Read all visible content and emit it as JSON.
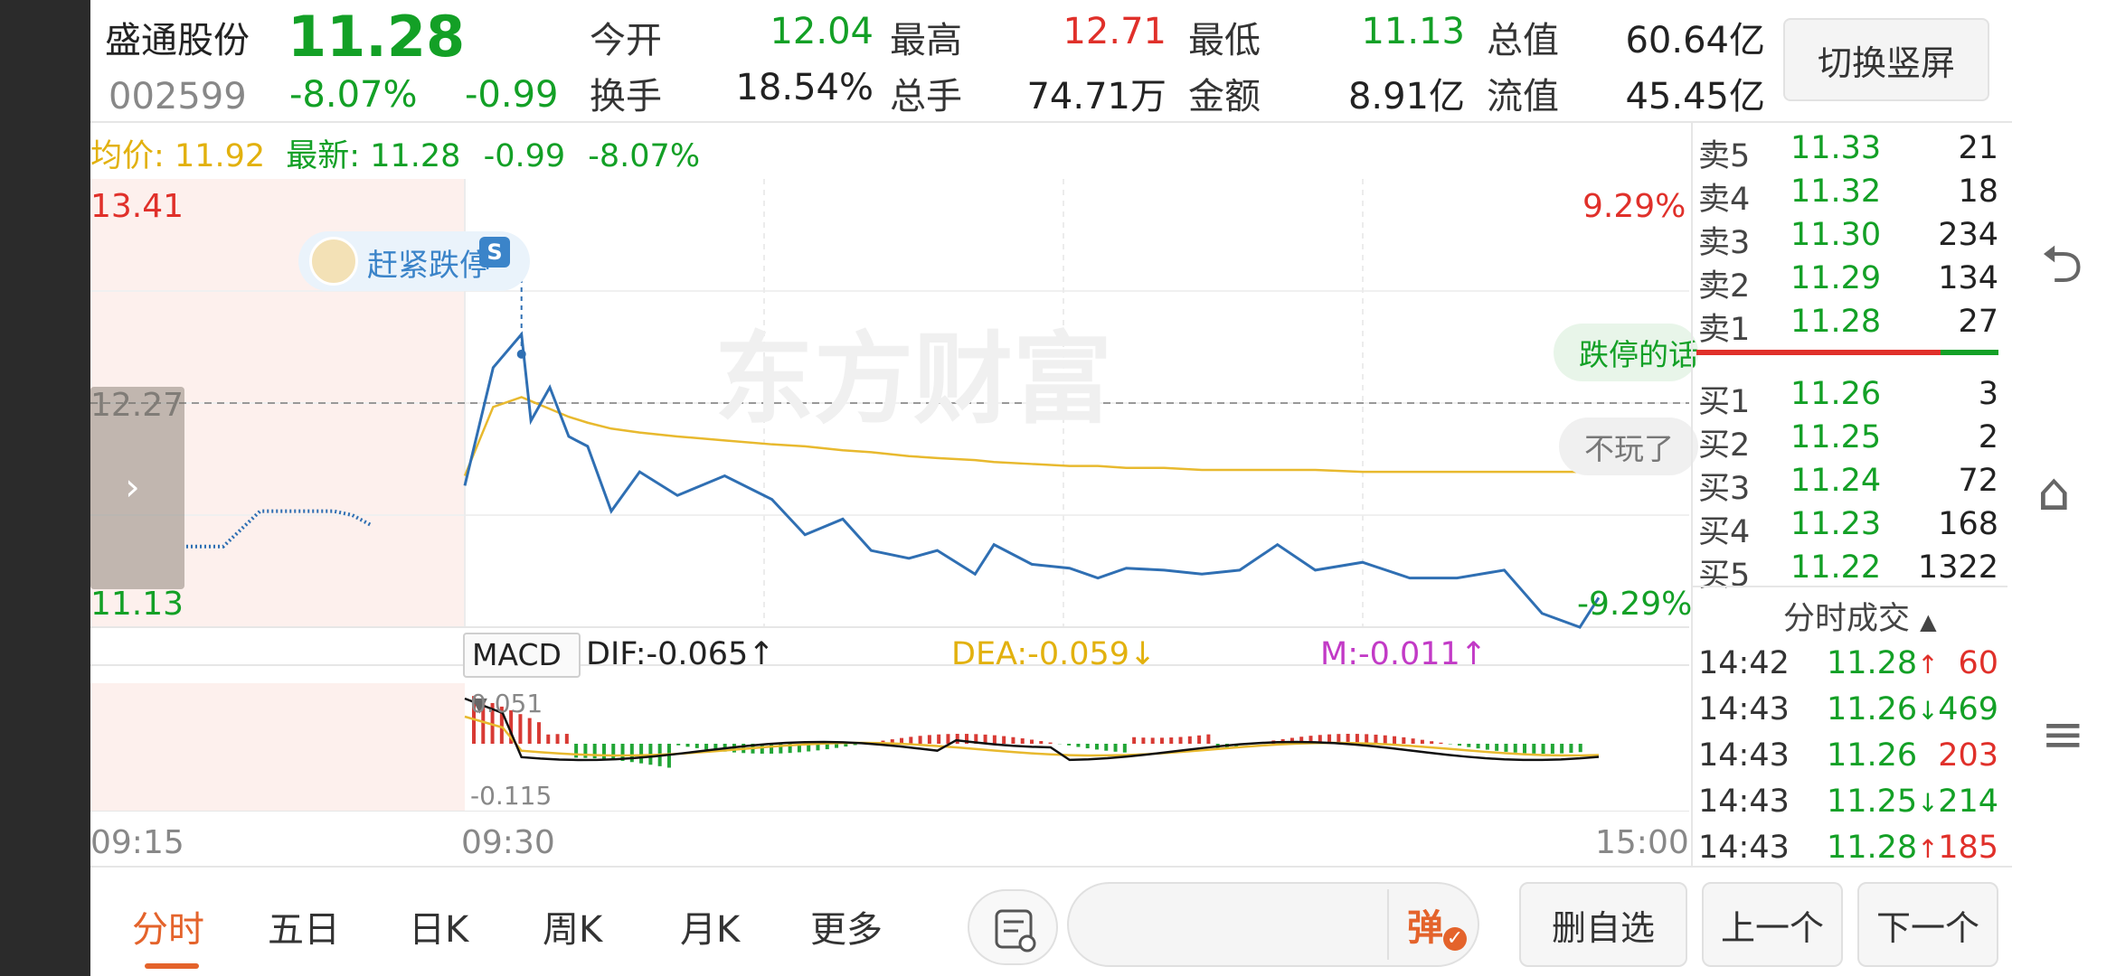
{
  "header": {
    "stock_name": "盛通股份",
    "price": "11.28",
    "code": "002599",
    "change_pct": "-8.07%",
    "change": "-0.99",
    "switch_label": "切换竖屏"
  },
  "stats": [
    {
      "label": "今开",
      "value": "12.04",
      "color": "#13a026"
    },
    {
      "label": "最高",
      "value": "12.71",
      "color": "#e0302a"
    },
    {
      "label": "最低",
      "value": "11.13",
      "color": "#13a026"
    },
    {
      "label": "总值",
      "value": "60.64亿",
      "color": "#222222"
    },
    {
      "label": "换手",
      "value": "18.54%",
      "color": "#222222"
    },
    {
      "label": "总手",
      "value": "74.71万",
      "color": "#222222"
    },
    {
      "label": "金额",
      "value": "8.91亿",
      "color": "#222222"
    },
    {
      "label": "流值",
      "value": "45.45亿",
      "color": "#222222"
    }
  ],
  "legend": {
    "avg_label": "均价:",
    "avg_value": "11.92",
    "latest_label": "最新:",
    "latest_value": "11.28",
    "change": "-0.99",
    "change_pct": "-8.07%"
  },
  "price_axis": {
    "high": "13.41",
    "mid": "12.27",
    "low": "11.13",
    "high_pct": "9.29%",
    "low_pct": "-9.29%"
  },
  "time_axis": [
    "09:15",
    "09:30",
    "15:00"
  ],
  "badge_text": "赶紧跌停",
  "side_pills": {
    "green": "跌停的话",
    "gray": "不玩了"
  },
  "watermark": "东方财富",
  "macd": {
    "selector": "MACD",
    "dif": "DIF:-0.065",
    "dea": "DEA:-0.059",
    "m": "M:-0.011",
    "top_value": "0.051",
    "bottom_value": "-0.115"
  },
  "order_book": {
    "asks": [
      {
        "label": "卖5",
        "price": "11.33",
        "vol": "21"
      },
      {
        "label": "卖4",
        "price": "11.32",
        "vol": "18"
      },
      {
        "label": "卖3",
        "price": "11.30",
        "vol": "234"
      },
      {
        "label": "卖2",
        "price": "11.29",
        "vol": "134"
      },
      {
        "label": "卖1",
        "price": "11.28",
        "vol": "27"
      }
    ],
    "bids": [
      {
        "label": "买1",
        "price": "11.26",
        "vol": "3"
      },
      {
        "label": "买2",
        "price": "11.25",
        "vol": "2"
      },
      {
        "label": "买3",
        "price": "11.24",
        "vol": "72"
      },
      {
        "label": "买4",
        "price": "11.23",
        "vol": "168"
      },
      {
        "label": "买5",
        "price": "11.22",
        "vol": "1322"
      }
    ]
  },
  "ticks": {
    "title": "分时成交",
    "rows": [
      {
        "time": "14:42",
        "price": "11.28",
        "arrow": "↑",
        "vol": "60",
        "vol_color": "#e0302a",
        "arrow_color": "#e0302a"
      },
      {
        "time": "14:43",
        "price": "11.26",
        "arrow": "↓",
        "vol": "469",
        "vol_color": "#13a026",
        "arrow_color": "#13a026"
      },
      {
        "time": "14:43",
        "price": "11.26",
        "arrow": "",
        "vol": "203",
        "vol_color": "#e0302a",
        "arrow_color": "#e0302a"
      },
      {
        "time": "14:43",
        "price": "11.25",
        "arrow": "↓",
        "vol": "214",
        "vol_color": "#13a026",
        "arrow_color": "#13a026"
      },
      {
        "time": "14:43",
        "price": "11.28",
        "arrow": "↑",
        "vol": "185",
        "vol_color": "#e0302a",
        "arrow_color": "#e0302a"
      }
    ]
  },
  "tabs": [
    "分时",
    "五日",
    "日K",
    "周K",
    "月K",
    "更多"
  ],
  "bottom": {
    "danmu": "弹",
    "remove_watch": "删自选",
    "prev": "上一个",
    "next": "下一个"
  },
  "chart_data": {
    "type": "line",
    "price_series_x_minutes": [
      0,
      6,
      12,
      14,
      18,
      22,
      26,
      31,
      37,
      45,
      55,
      65,
      72,
      80,
      86,
      94,
      100,
      108,
      112,
      120,
      128,
      134,
      140,
      148,
      156,
      164,
      172,
      180,
      190,
      200,
      210,
      220,
      228,
      236,
      240
    ],
    "price_series_y": [
      11.85,
      12.45,
      12.62,
      12.18,
      12.35,
      12.1,
      12.05,
      11.72,
      11.92,
      11.8,
      11.9,
      11.78,
      11.6,
      11.68,
      11.52,
      11.48,
      11.52,
      11.4,
      11.55,
      11.45,
      11.43,
      11.38,
      11.43,
      11.42,
      11.4,
      11.42,
      11.55,
      11.42,
      11.46,
      11.38,
      11.38,
      11.42,
      11.2,
      11.13,
      11.28
    ],
    "avg_series_y": [
      11.9,
      12.25,
      12.3,
      12.28,
      12.24,
      12.2,
      12.17,
      12.14,
      12.12,
      12.1,
      12.08,
      12.06,
      12.05,
      12.03,
      12.02,
      12.0,
      11.99,
      11.98,
      11.97,
      11.96,
      11.95,
      11.95,
      11.94,
      11.94,
      11.93,
      11.93,
      11.93,
      11.93,
      11.92,
      11.92,
      11.92,
      11.92,
      11.92,
      11.92,
      11.92
    ],
    "preopen_y": [
      11.54,
      11.54,
      11.54,
      11.63,
      11.72,
      11.72,
      11.72,
      11.72,
      11.72,
      11.7,
      11.65
    ],
    "ylim": [
      11.13,
      13.41
    ],
    "prev_close": 12.27,
    "macd_ylim": [
      -0.115,
      0.051
    ]
  }
}
